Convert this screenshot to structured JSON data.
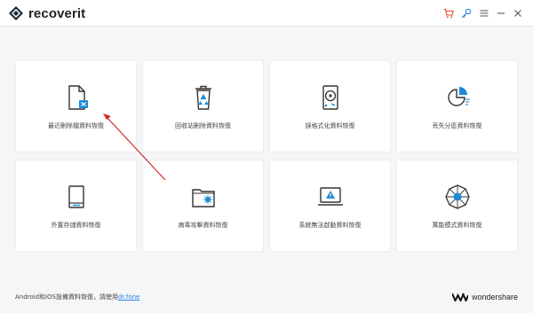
{
  "app": {
    "title": "recoverit"
  },
  "toolbar": {
    "cart_icon": "cart-icon",
    "key_icon": "key-icon",
    "menu_icon": "menu-icon",
    "minimize_icon": "minimize-icon",
    "close_icon": "close-icon",
    "cart_color": "#e8452c",
    "key_color": "#2a7de1"
  },
  "modes": [
    {
      "label": "最近刪除檔資料恢復",
      "icon": "deleted-file-icon"
    },
    {
      "label": "回收站刪除資料恢復",
      "icon": "recycle-bin-icon"
    },
    {
      "label": "誤格式化資料恢復",
      "icon": "hard-drive-icon"
    },
    {
      "label": "丟失分區資料恢復",
      "icon": "partition-icon"
    },
    {
      "label": "外置存儲資料恢復",
      "icon": "external-device-icon"
    },
    {
      "label": "病毒攻擊資料恢復",
      "icon": "virus-folder-icon"
    },
    {
      "label": "系統無法啟動資料恢復",
      "icon": "crashed-computer-icon"
    },
    {
      "label": "萬能模式資料恢復",
      "icon": "all-around-icon"
    }
  ],
  "footer": {
    "text": "Android和iOS設備資料恢復，請使用",
    "link": "dr.fone",
    "brand": "wondershare"
  },
  "accent_color": "#1a8ad4",
  "annotation_color": "#d62b2b"
}
